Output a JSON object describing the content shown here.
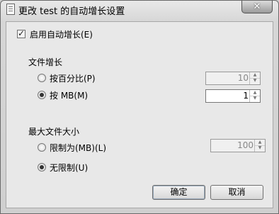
{
  "window": {
    "title": "更改 test 的自动增长设置",
    "close_symbol": "✕"
  },
  "autogrow": {
    "label": "启用自动增长(E)",
    "checked": true
  },
  "file_growth": {
    "heading": "文件增长",
    "percent_label": "按百分比(P)",
    "percent_value": "10",
    "mb_label": "按 MB(M)",
    "mb_value": "1",
    "selected": "mb"
  },
  "max_size": {
    "heading": "最大文件大小",
    "limit_label": "限制为(MB)(L)",
    "limit_value": "100",
    "unlimited_label": "无限制(U)",
    "selected": "unlimited"
  },
  "buttons": {
    "ok": "确定",
    "cancel": "取消"
  }
}
